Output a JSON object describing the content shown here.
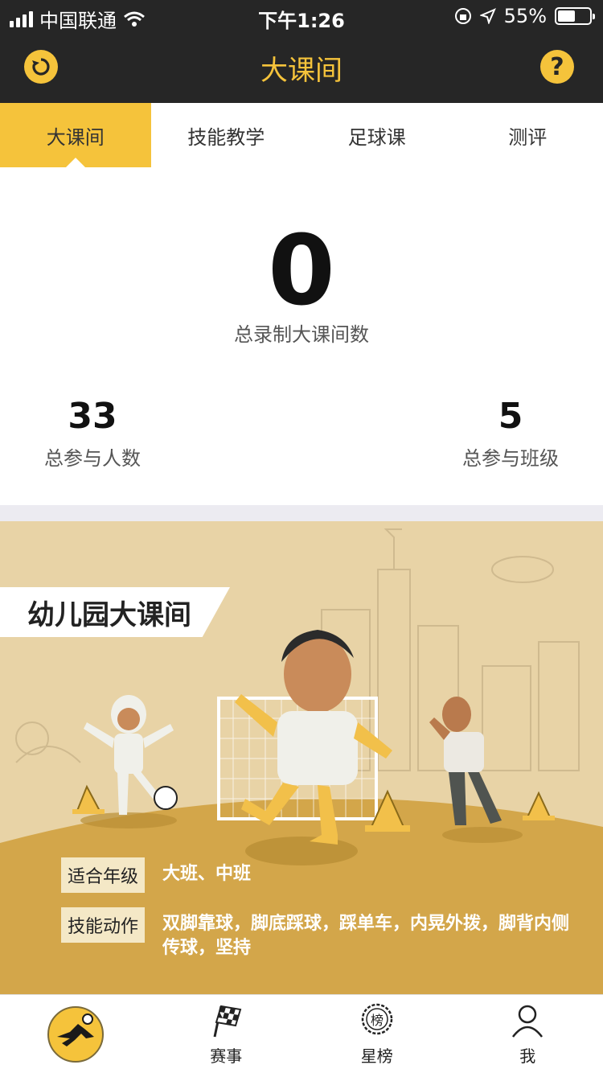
{
  "status": {
    "carrier": "中国联通",
    "time": "下午1:26",
    "battery": "55%",
    "battery_level": 0.55
  },
  "nav": {
    "title": "大课间",
    "left_icon": "refresh-icon",
    "right_icon": "help-icon",
    "help_glyph": "?"
  },
  "tabs": [
    {
      "label": "大课间",
      "active": true
    },
    {
      "label": "技能教学",
      "active": false
    },
    {
      "label": "足球课",
      "active": false
    },
    {
      "label": "测评",
      "active": false
    }
  ],
  "stats": {
    "main_value": "0",
    "main_label": "总录制大课间数",
    "participants_value": "33",
    "participants_label": "总参与人数",
    "classes_value": "5",
    "classes_label": "总参与班级"
  },
  "banner": {
    "title": "幼儿园大课间",
    "grade_tag": "适合年级",
    "grade_value": "大班、中班",
    "skill_tag": "技能动作",
    "skill_value": "双脚靠球，脚底踩球，踩单车，内晃外拨，脚背内侧传球，坚持"
  },
  "tabbar": [
    {
      "label": "",
      "icon": "home-soccer-icon"
    },
    {
      "label": "赛事",
      "icon": "checkered-flag-icon"
    },
    {
      "label": "星榜",
      "icon": "ranking-badge-icon",
      "glyph": "榜"
    },
    {
      "label": "我",
      "icon": "user-icon"
    }
  ],
  "colors": {
    "accent": "#f5c33b",
    "header_bg": "#262626",
    "banner_bg": "#e8d3a6",
    "banner_ground": "#d3a64a"
  }
}
